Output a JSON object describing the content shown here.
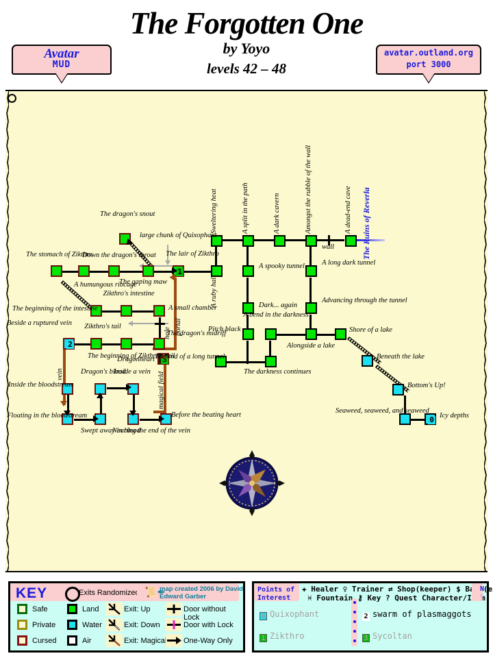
{
  "header": {
    "title": "The Forgotten One",
    "author": "by Yoyo",
    "levels": "levels 42 – 48",
    "banner_left_line1": "Avatar",
    "banner_left_line2": "MUD",
    "banner_right_line1": "avatar.outland.org",
    "banner_right_line2": "port 3000"
  },
  "map": {
    "region_label": "The Ruins of Reverla",
    "edge_labels": {
      "wall": "wall",
      "hole": "hole",
      "vein": "vein",
      "portal": "portal",
      "magical_field": "magical field"
    },
    "annotations": [
      "large chunk of Quixophant"
    ],
    "rooms": [
      {
        "id": "sweltering-heat",
        "label": "Sweltering heat",
        "type": "land"
      },
      {
        "id": "a-split-in-the-path",
        "label": "A split in the path",
        "type": "land"
      },
      {
        "id": "a-dark-cavern",
        "label": "A dark cavern",
        "type": "land"
      },
      {
        "id": "amongst-the-rubble",
        "label": "Amongst the rubble of the wall",
        "type": "land"
      },
      {
        "id": "a-dead-end-cave",
        "label": "A dead-end cave",
        "type": "land"
      },
      {
        "id": "a-ruby-hall",
        "label": "A ruby hall",
        "type": "land"
      },
      {
        "id": "a-spooky-tunnel",
        "label": "A spooky tunnel",
        "type": "land"
      },
      {
        "id": "a-long-dark-tunnel",
        "label": "A long dark tunnel",
        "type": "land"
      },
      {
        "id": "dark-again",
        "label": "Dark... again",
        "type": "land"
      },
      {
        "id": "advancing-through",
        "label": "Advancing through the tunnel",
        "type": "land"
      },
      {
        "id": "pitch-black",
        "label": "Pitch black",
        "type": "land"
      },
      {
        "id": "a-bend-in-the-darkness",
        "label": "A bend in the darkness",
        "type": "land"
      },
      {
        "id": "alongside-a-lake",
        "label": "Alongside a lake",
        "type": "land"
      },
      {
        "id": "shore-of-a-lake",
        "label": "Shore of a lake",
        "type": "land"
      },
      {
        "id": "end-of-long-tunnel",
        "label": "The end of a long tunnel",
        "type": "land"
      },
      {
        "id": "darkness-continues",
        "label": "The darkness continues",
        "type": "land"
      },
      {
        "id": "beneath-the-lake",
        "label": "Beneath the lake",
        "type": "water"
      },
      {
        "id": "bottoms-up",
        "label": "Bottom's Up!",
        "type": "water"
      },
      {
        "id": "seaweed",
        "label": "Seaweed, seaweed, and seaweed",
        "type": "water"
      },
      {
        "id": "icy-depths",
        "label": "Icy depths",
        "type": "water",
        "poi": "0"
      },
      {
        "id": "dragons-snout",
        "label": "The dragon's snout",
        "type": "cursed-land"
      },
      {
        "id": "stomach-of-zikthro",
        "label": "The stomach of Zikthro",
        "type": "cursed-land"
      },
      {
        "id": "humungous-ribcage",
        "label": "A humungous ribcage",
        "type": "cursed-land"
      },
      {
        "id": "down-the-dragons-throat",
        "label": "Down the dragon's throat",
        "type": "cursed-land"
      },
      {
        "id": "the-gaping-maw",
        "label": "The gaping maw",
        "type": "cursed-land"
      },
      {
        "id": "lair-of-zikthro",
        "label": "The lair of Zikthro",
        "type": "cursed-land",
        "poi": "1"
      },
      {
        "id": "beginning-of-intestine",
        "label": "The beginning of the intestine",
        "type": "cursed-land"
      },
      {
        "id": "zikthros-intestine",
        "label": "Zikthro's intestine",
        "type": "cursed-land"
      },
      {
        "id": "a-small-chamber",
        "label": "A small chamber",
        "type": "cursed-land"
      },
      {
        "id": "beside-ruptured-vein",
        "label": "Beside a ruptured vein",
        "type": "cursed-water",
        "poi": "2"
      },
      {
        "id": "zikthros-tail",
        "label": "Zikthro's tail",
        "type": "cursed-land"
      },
      {
        "id": "beginning-of-tail",
        "label": "The beginning of Zikthro's tail",
        "type": "cursed-land"
      },
      {
        "id": "dragons-midriff",
        "label": "The dragon's midriff",
        "type": "cursed-land"
      },
      {
        "id": "dragonheart",
        "label": "Dragonheart",
        "type": "dark",
        "poi": "3"
      },
      {
        "id": "inside-the-bloodstream",
        "label": "Inside the bloodstream",
        "type": "cursed-water"
      },
      {
        "id": "dragons-blood",
        "label": "Dragon's blood",
        "type": "cursed-water"
      },
      {
        "id": "inside-a-vein",
        "label": "Inside a vein",
        "type": "cursed-water"
      },
      {
        "id": "floating-in-bloodstream",
        "label": "Floating in the bloodstream",
        "type": "cursed-water"
      },
      {
        "id": "swept-away-in-blood",
        "label": "Swept away in blood",
        "type": "cursed-water"
      },
      {
        "id": "nearing-end-of-vein",
        "label": "Nearing the end of the vein",
        "type": "cursed-water"
      },
      {
        "id": "before-beating-heart",
        "label": "Before the beating heart",
        "type": "cursed-water"
      }
    ]
  },
  "key": {
    "title": "KEY",
    "randomized_label": "Exits Randomized",
    "credit": "map created 2006 by David Edward Garber",
    "room_types": [
      {
        "name": "Safe",
        "fill": "#fbf7cf",
        "border": "#0a6b0a"
      },
      {
        "name": "Private",
        "fill": "#fbf7cf",
        "border": "#9a8d11"
      },
      {
        "name": "Cursed",
        "fill": "#fbf7cf",
        "border": "#8b1212"
      },
      {
        "name": "Land",
        "fill": "#00e800",
        "border": "#000000"
      },
      {
        "name": "Water",
        "fill": "#1ae0f0",
        "border": "#000000"
      },
      {
        "name": "Air",
        "fill": "#ffffff",
        "border": "#000000"
      }
    ],
    "exits": [
      {
        "name": "Exit: Up"
      },
      {
        "name": "Exit: Down"
      },
      {
        "name": "Exit: Magical"
      }
    ],
    "doors": [
      {
        "name": "Door without Lock"
      },
      {
        "name": "Door with Lock"
      },
      {
        "name": "One-Way Only"
      }
    ]
  },
  "poi": {
    "title_line1": "Points of",
    "title_line2": "Interest",
    "header_row1": "✚ Healer ♀ Trainer ⇄ Shop(keeper) $ Bank(er)",
    "header_row2": "♓ Fountain ⚷ Key ? Quest Character/Item",
    "compass_n": "N",
    "entries": [
      {
        "chip": "0",
        "chip_color": "#1ae0f0",
        "label": "Quixophant",
        "active": false
      },
      {
        "chip": "2",
        "chip_color": "#1ae0f0",
        "label": "swarm of plasmaggots",
        "active": true
      },
      {
        "chip": "1",
        "chip_color": "#00c000",
        "label": "Zikthro",
        "active": false
      },
      {
        "chip": "3",
        "chip_color": "#00c000",
        "label": "Sycoltan",
        "active": false
      }
    ]
  }
}
